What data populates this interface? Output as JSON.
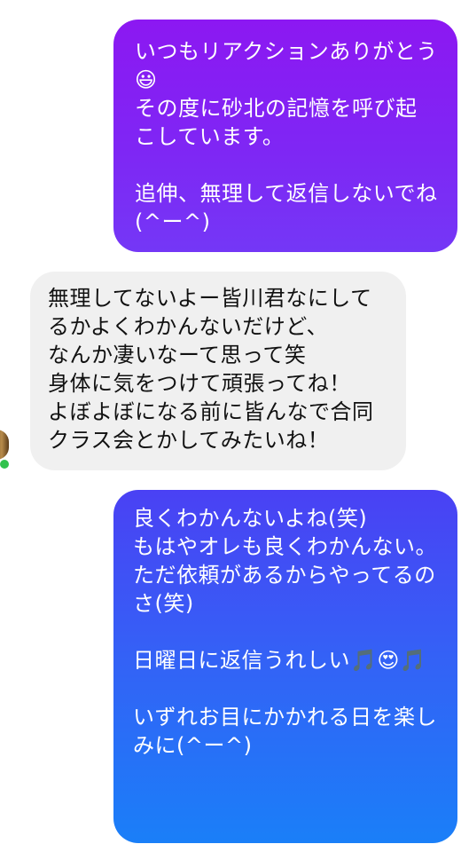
{
  "messages": [
    {
      "direction": "outgoing",
      "text": "いつもリアクションありがとう😃\nその度に砂北の記憶を呼び起こしています。\n\n追伸、無理して返信しないでね(^ー^)"
    },
    {
      "direction": "incoming",
      "text": "無理してないよー皆川君なにしてるかよくわかんないだけど、\nなんか凄いなーて思って笑\n身体に気をつけて頑張ってね！\nよぼよぼになる前に皆んなで合同クラス会とかしてみたいね！"
    },
    {
      "direction": "outgoing",
      "text": "良くわかんないよね(笑)\nもはやオレも良くわかんない。\nただ依頼があるからやってるのさ(笑)\n\n日曜日に返信うれしい🎵😍🎵\n\nいずれお目にかかれる日を楽しみに(^ー^)"
    }
  ],
  "contact": {
    "avatar_icon": "contact-avatar-icon",
    "status": "online",
    "status_color": "#31c24d"
  },
  "colors": {
    "outgoing_top": "#8c18f2",
    "outgoing_bottom": "#1a7ff8",
    "incoming_background": "#f0f0f0"
  }
}
